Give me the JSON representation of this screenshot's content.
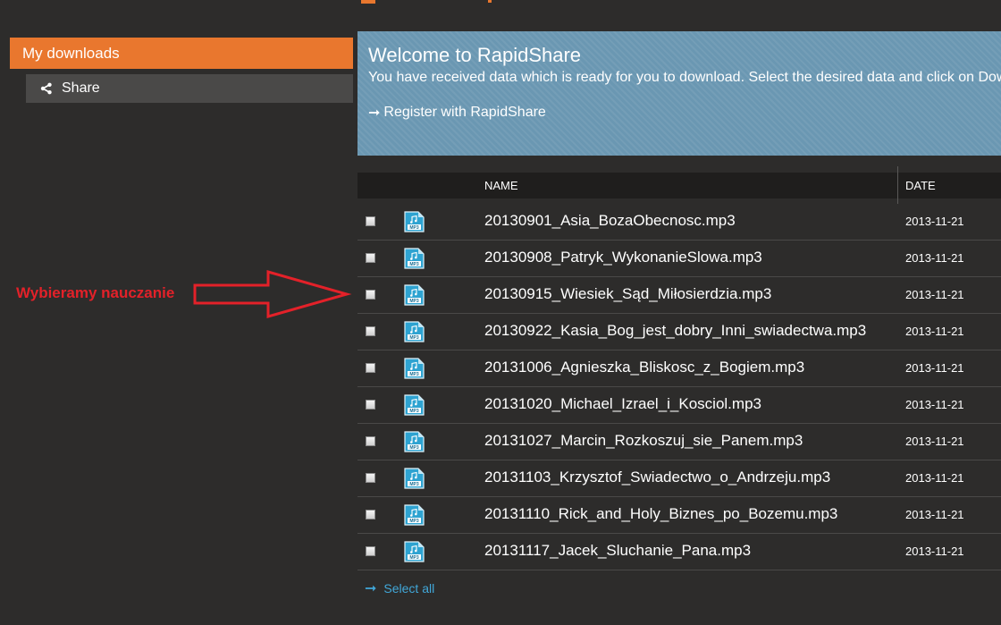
{
  "sidebar": {
    "main_item": "My downloads",
    "sub_item": "Share"
  },
  "welcome": {
    "title": "Welcome to RapidShare",
    "message": "You have received data which is ready for you to download. Select the desired data and click on Download.",
    "register_link": "Register with RapidShare"
  },
  "table": {
    "columns": [
      "NAME",
      "DATE"
    ],
    "rows": [
      {
        "name": "20130901_Asia_BozaObecnosc.mp3",
        "date": "2013-11-21"
      },
      {
        "name": "20130908_Patryk_WykonanieSlowa.mp3",
        "date": "2013-11-21"
      },
      {
        "name": "20130915_Wiesiek_Sąd_Miłosierdzia.mp3",
        "date": "2013-11-21"
      },
      {
        "name": "20130922_Kasia_Bog_jest_dobry_Inni_swiadectwa.mp3",
        "date": "2013-11-21"
      },
      {
        "name": "20131006_Agnieszka_Bliskosc_z_Bogiem.mp3",
        "date": "2013-11-21"
      },
      {
        "name": "20131020_Michael_Izrael_i_Kosciol.mp3",
        "date": "2013-11-21"
      },
      {
        "name": "20131027_Marcin_Rozkoszuj_sie_Panem.mp3",
        "date": "2013-11-21"
      },
      {
        "name": "20131103_Krzysztof_Swiadectwo_o_Andrzeju.mp3",
        "date": "2013-11-21"
      },
      {
        "name": "20131110_Rick_and_Holy_Biznes_po_Bozemu.mp3",
        "date": "2013-11-21"
      },
      {
        "name": "20131117_Jacek_Sluchanie_Pana.mp3",
        "date": "2013-11-21"
      }
    ],
    "select_all": "Select all"
  },
  "annotation": {
    "text": "Wybieramy nauczanie",
    "color": "#e32129"
  },
  "icons": {
    "file": "mp3-file-icon",
    "share": "share-icon",
    "arrow": "arrow-right-icon"
  },
  "colors": {
    "accent": "#e9772e",
    "banner": "#6a97b2",
    "link": "#41a7d8"
  }
}
